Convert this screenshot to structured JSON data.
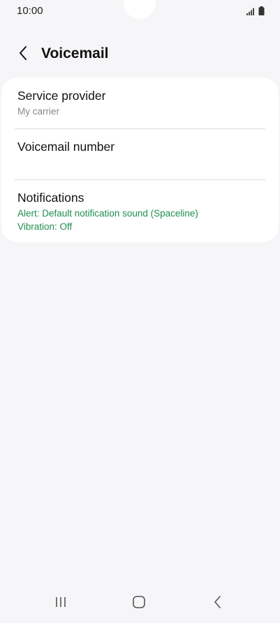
{
  "status_bar": {
    "time": "10:00"
  },
  "header": {
    "title": "Voicemail"
  },
  "settings": {
    "service_provider": {
      "title": "Service provider",
      "value": "My carrier"
    },
    "voicemail_number": {
      "title": "Voicemail number",
      "value": ""
    },
    "notifications": {
      "title": "Notifications",
      "alert": "Alert: Default notification sound (Spaceline)",
      "vibration": "Vibration: Off"
    }
  },
  "colors": {
    "background": "#f6f6f8",
    "card": "#ffffff",
    "accent_green": "#1e8e4e",
    "secondary_text": "#888888"
  },
  "icons": {
    "back": "chevron-left-icon",
    "signal": "signal-icon",
    "battery": "battery-icon",
    "recents": "recents-icon",
    "home": "home-icon",
    "nav_back": "nav-back-icon"
  }
}
